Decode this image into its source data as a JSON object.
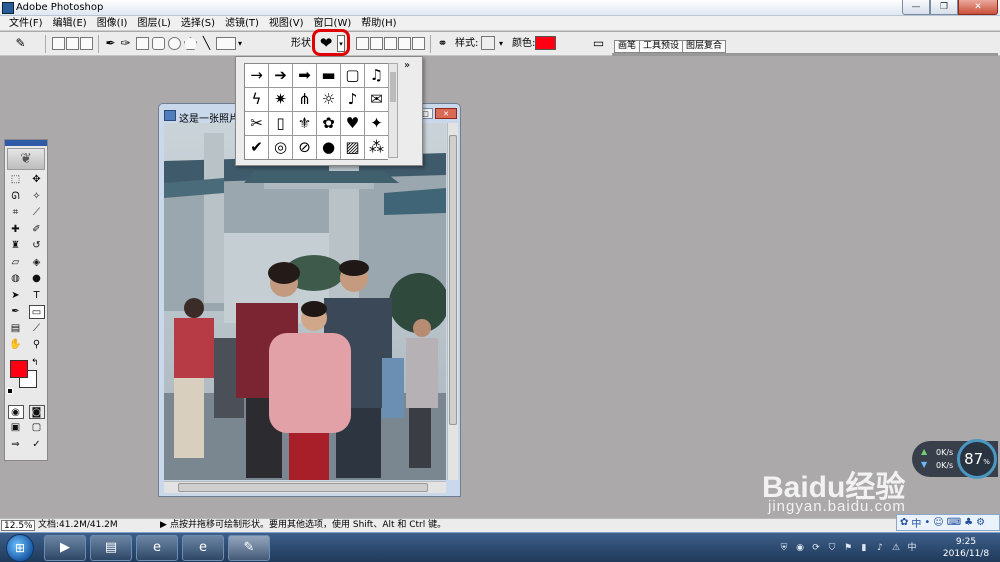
{
  "window": {
    "title": "Adobe Photoshop",
    "controls": [
      "—",
      "❐",
      "✕"
    ]
  },
  "menu": [
    "文件(F)",
    "编辑(E)",
    "图像(I)",
    "图层(L)",
    "选择(S)",
    "滤镜(T)",
    "视图(V)",
    "窗口(W)",
    "帮助(H)"
  ],
  "options_bar": {
    "shape_label": "形状:",
    "shape_value": "❤",
    "style_label": "样式:",
    "color_label": "颜色:",
    "color_value": "#ff0013",
    "palette_tabs": [
      "画笔",
      "工具预设",
      "图层复合"
    ]
  },
  "shape_picker": {
    "menu_button": "»",
    "shapes": [
      "→",
      "➔",
      "➡",
      "▬",
      "▢",
      "♫",
      "ϟ",
      "✷",
      "⋔",
      "☼",
      "♪",
      "✉",
      "✂",
      "▯",
      "⚜",
      "✿",
      "♥",
      "✦",
      "✔",
      "◎",
      "⊘",
      "●",
      "▨",
      "⁂"
    ]
  },
  "document": {
    "title": "这是一张照片",
    "controls": [
      "_",
      "□",
      "✕"
    ]
  },
  "status_bar": {
    "zoom": "12.5%",
    "doc_size": "文档:41.2M/41.2M",
    "arrow": "▶",
    "hint": "点按并拖移可绘制形状。要用其他选项，使用 Shift、Alt 和 Ctrl 键。"
  },
  "overlay": {
    "net_up": "0K/s",
    "net_down": "0K/s",
    "gauge_value": "87",
    "gauge_unit": "%",
    "watermark": "Baidu经验",
    "watermark_url": "jingyan.baidu.com",
    "ime": "中"
  },
  "taskbar": {
    "start": "⊞",
    "apps": [
      {
        "name": "media-player",
        "glyph": "▶"
      },
      {
        "name": "file-explorer",
        "glyph": "▤"
      },
      {
        "name": "internet-explorer",
        "glyph": "e"
      },
      {
        "name": "internet-explorer-2",
        "glyph": "e"
      },
      {
        "name": "photoshop",
        "glyph": "✎"
      }
    ],
    "time": "9:25",
    "date": "2016/11/8"
  }
}
